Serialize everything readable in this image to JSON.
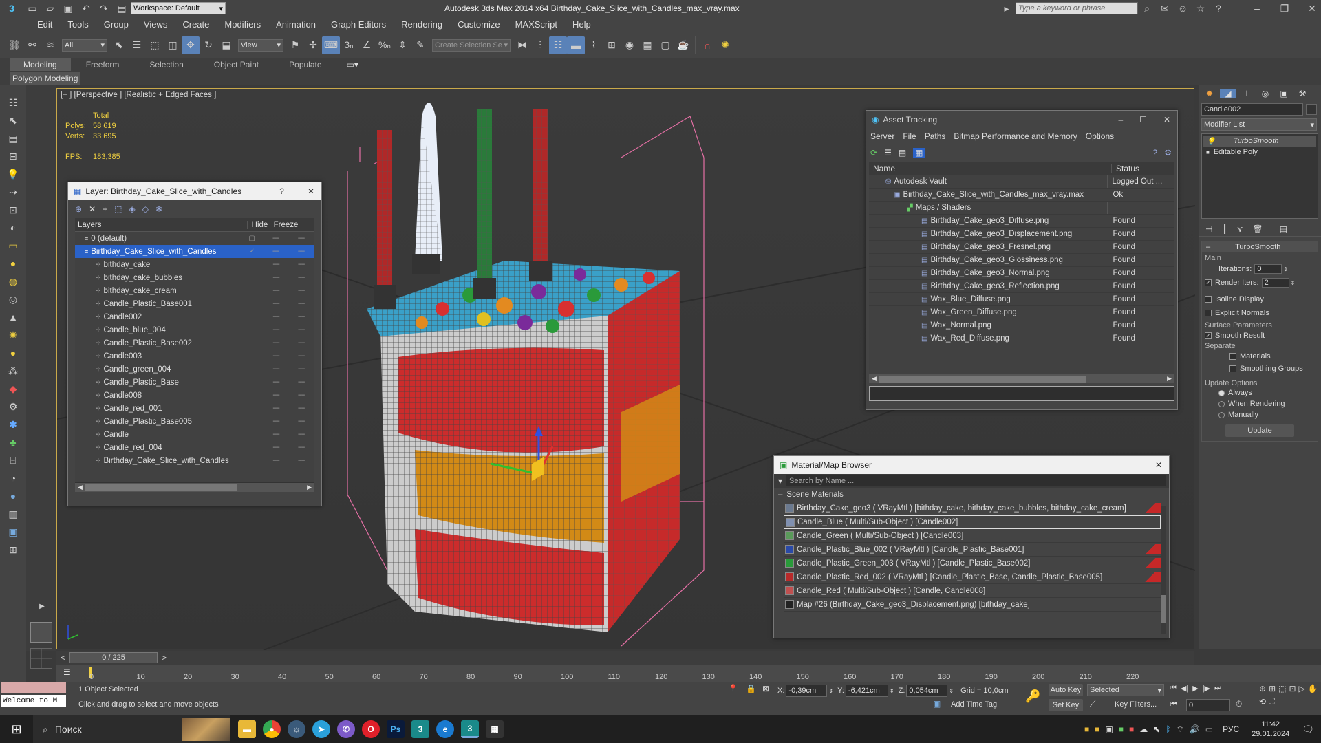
{
  "titlebar": {
    "workspace_label": "Workspace: Default",
    "app_title": "Autodesk 3ds Max  2014 x64     Birthday_Cake_Slice_with_Candles_max_vray.max",
    "search_placeholder": "Type a keyword or phrase"
  },
  "menu": [
    "Edit",
    "Tools",
    "Group",
    "Views",
    "Create",
    "Modifiers",
    "Animation",
    "Graph Editors",
    "Rendering",
    "Customize",
    "MAXScript",
    "Help"
  ],
  "toolbar": {
    "filter": "All",
    "refcoord": "View",
    "selset": "Create Selection Se"
  },
  "ribbon": {
    "tabs": [
      "Modeling",
      "Freeform",
      "Selection",
      "Object Paint",
      "Populate"
    ],
    "sub": "Polygon Modeling"
  },
  "viewport": {
    "label": "[+ ] [Perspective ] [Realistic + Edged Faces ]",
    "stats": {
      "total": "Total",
      "polys_label": "Polys:",
      "polys": "58 619",
      "verts_label": "Verts:",
      "verts": "33 695",
      "fps_label": "FPS:",
      "fps": "183,385"
    }
  },
  "layer_window": {
    "title": "Layer: Birthday_Cake_Slice_with_Candles",
    "help": "?",
    "cols": [
      "Layers",
      "Hide",
      "Freeze"
    ],
    "items": [
      "0 (default)",
      "Birthday_Cake_Slice_with_Candles",
      "bithday_cake",
      "bithday_cake_bubbles",
      "bithday_cake_cream",
      "Candle_Plastic_Base001",
      "Candle002",
      "Candle_blue_004",
      "Candle_Plastic_Base002",
      "Candle003",
      "Candle_green_004",
      "Candle_Plastic_Base",
      "Candle008",
      "Candle_red_001",
      "Candle_Plastic_Base005",
      "Candle",
      "Candle_red_004",
      "Birthday_Cake_Slice_with_Candles"
    ]
  },
  "asset_window": {
    "title": "Asset Tracking",
    "menu": [
      "Server",
      "File",
      "Paths",
      "Bitmap Performance and Memory",
      "Options"
    ],
    "cols": [
      "Name",
      "Status"
    ],
    "rows": [
      {
        "name": "Autodesk Vault",
        "status": "Logged Out ..."
      },
      {
        "name": "Birthday_Cake_Slice_with_Candles_max_vray.max",
        "status": "Ok"
      },
      {
        "name": "Maps / Shaders",
        "status": ""
      },
      {
        "name": "Birthday_Cake_geo3_Diffuse.png",
        "status": "Found"
      },
      {
        "name": "Birthday_Cake_geo3_Displacement.png",
        "status": "Found"
      },
      {
        "name": "Birthday_Cake_geo3_Fresnel.png",
        "status": "Found"
      },
      {
        "name": "Birthday_Cake_geo3_Glossiness.png",
        "status": "Found"
      },
      {
        "name": "Birthday_Cake_geo3_Normal.png",
        "status": "Found"
      },
      {
        "name": "Birthday_Cake_geo3_Reflection.png",
        "status": "Found"
      },
      {
        "name": "Wax_Blue_Diffuse.png",
        "status": "Found"
      },
      {
        "name": "Wax_Green_Diffuse.png",
        "status": "Found"
      },
      {
        "name": "Wax_Normal.png",
        "status": "Found"
      },
      {
        "name": "Wax_Red_Diffuse.png",
        "status": "Found"
      }
    ]
  },
  "material_window": {
    "title": "Material/Map Browser",
    "search_placeholder": "Search by Name ...",
    "section": "Scene Materials",
    "items": [
      {
        "text": "Birthday_Cake_geo3  ( VRayMtl ) [bithday_cake, bithday_cake_bubbles, bithday_cake_cream]",
        "color": "#6b7a90"
      },
      {
        "text": "Candle_Blue  ( Multi/Sub-Object ) [Candle002]",
        "color": "#8090b0"
      },
      {
        "text": "Candle_Green  ( Multi/Sub-Object ) [Candle003]",
        "color": "#5a9a5a"
      },
      {
        "text": "Candle_Plastic_Blue_002  ( VRayMtl ) [Candle_Plastic_Base001]",
        "color": "#2a4aa8"
      },
      {
        "text": "Candle_Plastic_Green_003  ( VRayMtl ) [Candle_Plastic_Base002]",
        "color": "#2a9a3a"
      },
      {
        "text": "Candle_Plastic_Red_002  ( VRayMtl ) [Candle_Plastic_Base, Candle_Plastic_Base005]",
        "color": "#b82a2a"
      },
      {
        "text": "Candle_Red  ( Multi/Sub-Object ) [Candle, Candle008]",
        "color": "#c05050"
      },
      {
        "text": "Map #26 (Birthday_Cake_geo3_Displacement.png) [bithday_cake]",
        "color": "#222"
      }
    ]
  },
  "cmdpanel": {
    "object_name": "Candle002",
    "modifier_list": "Modifier List",
    "stack": [
      "TurboSmooth",
      "Editable Poly"
    ],
    "ts": {
      "title": "TurboSmooth",
      "main": "Main",
      "iterations_label": "Iterations:",
      "iterations": "0",
      "render_iters_label": "Render Iters:",
      "render_iters": "2",
      "isoline": "Isoline Display",
      "explicit": "Explicit Normals",
      "surface": "Surface Parameters",
      "smooth": "Smooth Result",
      "separate": "Separate",
      "materials": "Materials",
      "smoothing": "Smoothing Groups",
      "update_opts": "Update Options",
      "always": "Always",
      "when_rendering": "When Rendering",
      "manually": "Manually",
      "update_btn": "Update"
    }
  },
  "timeline": {
    "frame": "0 / 225",
    "ticks": [
      "0",
      "10",
      "20",
      "30",
      "40",
      "50",
      "60",
      "70",
      "80",
      "90",
      "100",
      "110",
      "120",
      "130",
      "140",
      "150",
      "160",
      "170",
      "180",
      "190",
      "200",
      "210",
      "220"
    ]
  },
  "status": {
    "welcome": "Welcome to M",
    "selected": "1 Object Selected",
    "prompt": "Click and drag to select and move objects",
    "x": "-0,39cm",
    "y": "-6,421cm",
    "z": "0,054cm",
    "grid": "Grid = 10,0cm",
    "add_time_tag": "Add Time Tag",
    "auto_key": "Auto Key",
    "selected_dd": "Selected",
    "set_key": "Set Key",
    "key_filters": "Key Filters...",
    "frame_field": "0"
  },
  "taskbar": {
    "search": "Поиск",
    "lang": "РУС",
    "time": "11:42",
    "date": "29.01.2024"
  }
}
